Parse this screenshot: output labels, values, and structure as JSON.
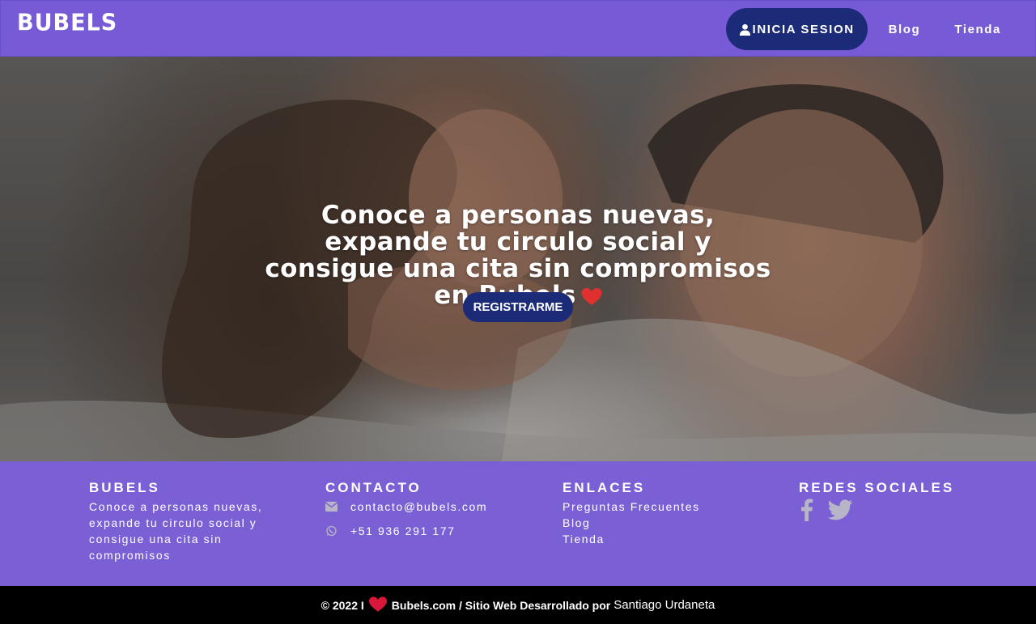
{
  "header": {
    "logo": "BUBELS",
    "login_label": "INICIA SESION",
    "nav": [
      "Blog",
      "Tienda"
    ]
  },
  "hero": {
    "headline": "Conoce a personas nuevas, expande tu circulo social y consigue una cita sin compromisos en Bubels",
    "register_label": "REGISTRARME"
  },
  "footer": {
    "about": {
      "title": "BUBELS",
      "text": "Conoce a personas nuevas, expande tu circulo social y consigue una cita sin compromisos"
    },
    "contact": {
      "title": "CONTACTO",
      "email": "contacto@bubels.com",
      "phone": "+51 936 291 177"
    },
    "links": {
      "title": "ENLACES",
      "items": [
        "Preguntas Frecuentes",
        "Blog",
        "Tienda"
      ]
    },
    "social": {
      "title": "REDES SOCIALES",
      "icons": [
        "facebook-icon",
        "twitter-icon"
      ]
    }
  },
  "bottom": {
    "copyright": "© 2022 I",
    "site": "Bubels.com / Sitio Web Desarrollado por",
    "developer": "Santiago Urdaneta"
  },
  "colors": {
    "brand_purple": "#775ad6",
    "button_navy": "#1c2b78",
    "heart_red": "#e0312f"
  }
}
